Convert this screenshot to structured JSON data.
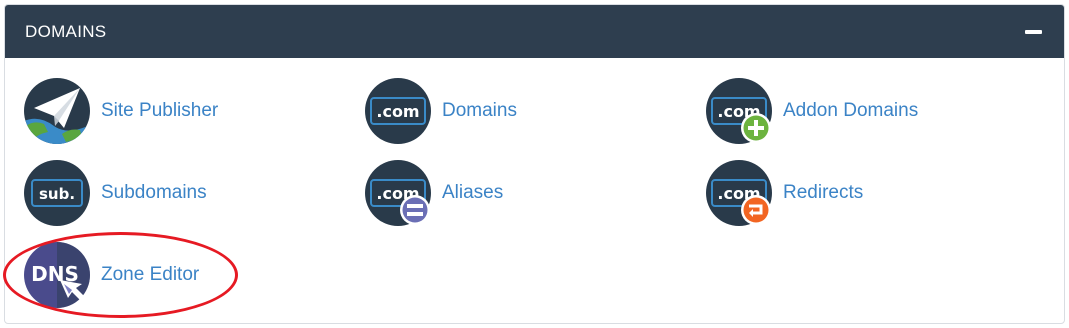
{
  "panel": {
    "title": "DOMAINS",
    "collapse_icon": "minus-icon"
  },
  "items": [
    {
      "label": "Site Publisher",
      "icon": "paper-plane-globe-icon"
    },
    {
      "label": "Domains",
      "icon": "dotcom-icon",
      "icon_text": ".com"
    },
    {
      "label": "Addon Domains",
      "icon": "dotcom-plus-icon",
      "icon_text": ".com"
    },
    {
      "label": "Subdomains",
      "icon": "sub-icon",
      "icon_text": "sub."
    },
    {
      "label": "Aliases",
      "icon": "dotcom-equals-icon",
      "icon_text": ".com"
    },
    {
      "label": "Redirects",
      "icon": "dotcom-redirect-icon",
      "icon_text": ".com"
    },
    {
      "label": "Zone Editor",
      "icon": "dns-icon",
      "icon_text": "DNS"
    }
  ],
  "annotation": {
    "color": "#e61a23",
    "target": "Zone Editor"
  },
  "colors": {
    "header_bg": "#2e3e4f",
    "link": "#3b83c6",
    "icon_dark": "#293a4a",
    "plus_green": "#6cb33f",
    "equals_purple": "#6b6fb5",
    "redirect_orange": "#f26522",
    "dns_purple": "#4a4b8c"
  }
}
